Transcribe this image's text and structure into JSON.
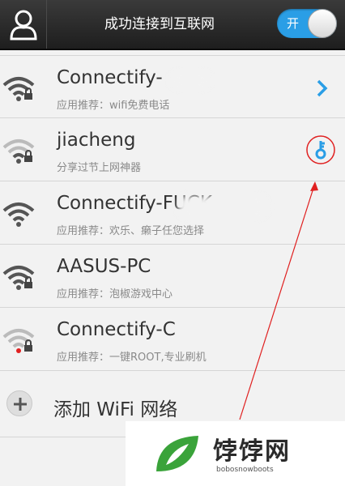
{
  "header": {
    "title": "成功连接到互联网",
    "toggle_label": "开"
  },
  "networks": [
    {
      "ssid": "Connectify-",
      "subtitle": "应用推荐：wifi免费电话",
      "action": "chevron-right-icon",
      "signal": "strong-locked"
    },
    {
      "ssid": "jiacheng",
      "subtitle": "分享过节上网神器",
      "action": "key-icon",
      "signal": "medium-locked"
    },
    {
      "ssid": "Connectify-FUCK",
      "subtitle": "应用推荐：欢乐、癞子任您选择",
      "action": "",
      "signal": "strong"
    },
    {
      "ssid": "AASUS-PC",
      "subtitle": "应用推荐：泡椒游戏中心",
      "action": "",
      "signal": "strong-locked"
    },
    {
      "ssid": "Connectify-C",
      "subtitle": "应用推荐：一键ROOT,专业刷机",
      "action": "",
      "signal": "weak-locked"
    }
  ],
  "add_network": {
    "label": "添加 WiFi 网络"
  },
  "watermark": {
    "name": "饽饽网",
    "domain": "bobosnowboots"
  },
  "colors": {
    "accent": "#2a9ee6",
    "annotation": "#e02020"
  }
}
